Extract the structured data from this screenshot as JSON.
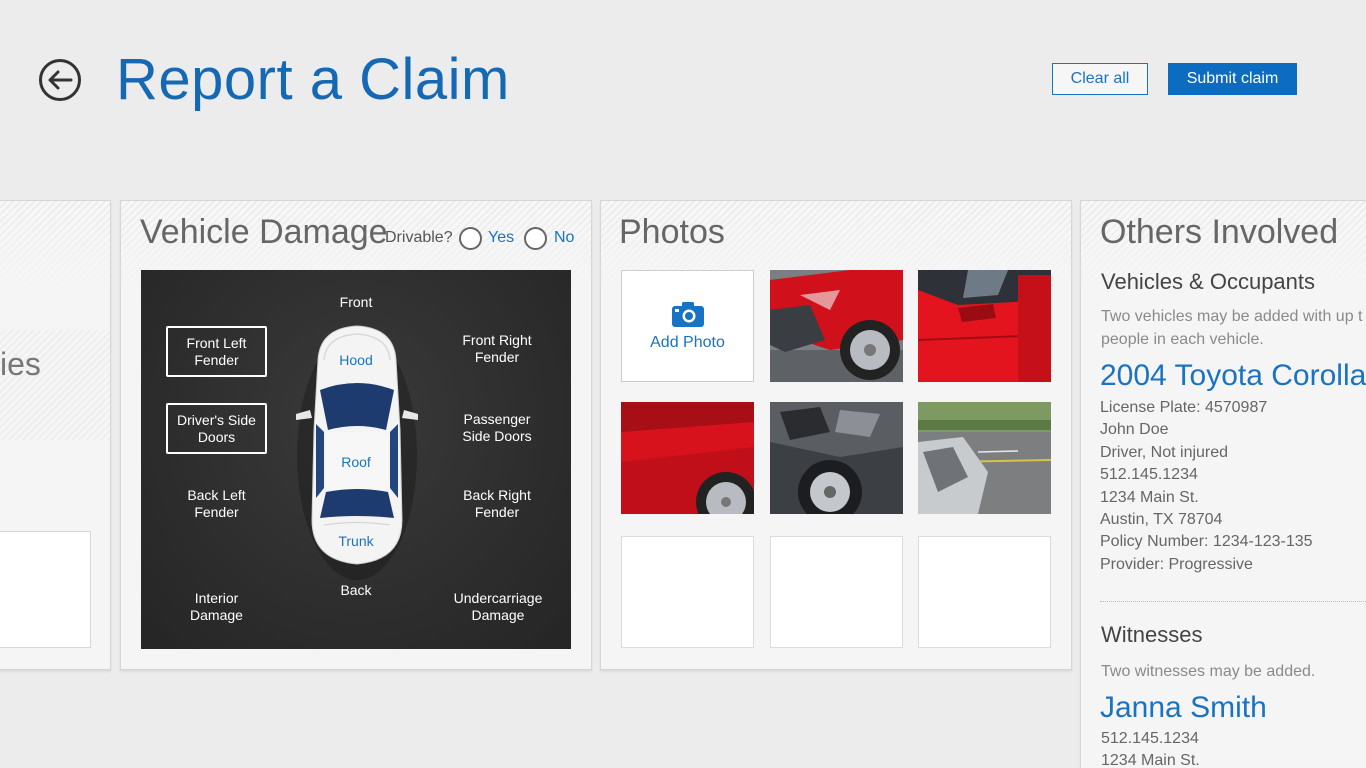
{
  "header": {
    "title": "Report a Claim",
    "clear_label": "Clear all",
    "submit_label": "Submit claim"
  },
  "left_panel": {
    "partial_text": "ies"
  },
  "vehicle_damage": {
    "title": "Vehicle Damage",
    "drivable_label": "Drivable?",
    "yes_label": "Yes",
    "no_label": "No",
    "zones": {
      "front": "Front",
      "back": "Back",
      "front_left_fender": "Front Left Fender",
      "front_right_fender": "Front Right Fender",
      "drivers_side_doors": "Driver's Side Doors",
      "passenger_side_doors": "Passenger Side Doors",
      "back_left_fender": "Back Left Fender",
      "back_right_fender": "Back Right Fender",
      "interior_damage": "Interior Damage",
      "undercarriage_damage": "Undercarriage Damage"
    },
    "car_parts": {
      "hood": "Hood",
      "roof": "Roof",
      "trunk": "Trunk"
    },
    "selected_zones": [
      "front_left_fender",
      "drivers_side_doors"
    ]
  },
  "photos": {
    "title": "Photos",
    "add_label": "Add Photo"
  },
  "others": {
    "title": "Others Involved",
    "vehicles_heading": "Vehicles & Occupants",
    "vehicles_note": "Two vehicles may be added with up t people in each vehicle.",
    "vehicle": {
      "name": "2004 Toyota Corolla",
      "license": "License Plate: 4570987",
      "driver_name": "John Doe",
      "driver_status": "Driver, Not injured",
      "phone": "512.145.1234",
      "street": "1234 Main St.",
      "city": "Austin, TX 78704",
      "policy": "Policy Number: 1234-123-135",
      "provider": "Provider: Progressive"
    },
    "witnesses_heading": "Witnesses",
    "witnesses_note": "Two witnesses may be added.",
    "witness": {
      "name": "Janna Smith",
      "phone": "512.145.1234",
      "street": "1234 Main St."
    }
  },
  "colors": {
    "accent": "#1a73c2",
    "submit_bg": "#0b6cc1",
    "board_bg": "#2b2b2b",
    "page_bg": "#ececec"
  }
}
